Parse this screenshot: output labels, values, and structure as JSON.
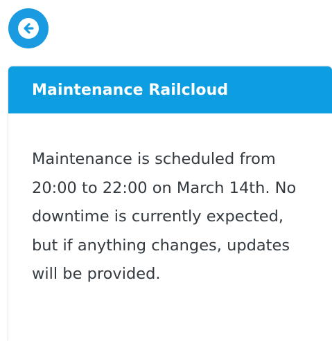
{
  "back_button": {
    "icon": "arrow-left-icon",
    "color": "#1a9ae0"
  },
  "card": {
    "title": "Maintenance Railcloud",
    "header_color": "#0c9ee0",
    "body_text": "Maintenance is scheduled from 20:00 to 22:00 on March 14th. No downtime is currently expected, but if anything changes, updates will be provided."
  }
}
